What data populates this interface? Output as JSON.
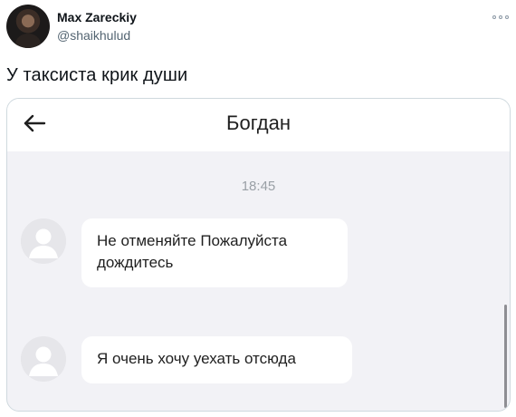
{
  "tweet": {
    "author_name": "Max Zareckiy",
    "author_handle": "@shaikhulud",
    "text": "У таксиста крик души",
    "more_icon": "more-options-icon"
  },
  "chat": {
    "back_icon": "arrow-left-icon",
    "contact_name": "Богдан",
    "timestamp": "18:45",
    "messages": [
      {
        "text": "Не отменяйте Пожалуйста дождитесь"
      },
      {
        "text": "Я очень хочу уехать отсюда"
      }
    ]
  },
  "colors": {
    "chat_background": "#f2f2f6",
    "bubble_background": "#ffffff",
    "secondary_text": "#536471",
    "card_border": "#cfd9de"
  }
}
